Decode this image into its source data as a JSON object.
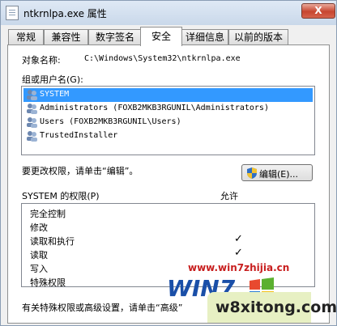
{
  "window": {
    "title": "ntkrnlpa.exe 属性",
    "close_label": "X"
  },
  "tabs": [
    {
      "label": "常规"
    },
    {
      "label": "兼容性"
    },
    {
      "label": "数字签名"
    },
    {
      "label": "安全"
    },
    {
      "label": "详细信息"
    },
    {
      "label": "以前的版本"
    }
  ],
  "active_tab": "安全",
  "object": {
    "label": "对象名称:",
    "value": "C:\\Windows\\System32\\ntkrnlpa.exe"
  },
  "groups": {
    "label": "组或用户名(G):",
    "items": [
      {
        "name": "SYSTEM",
        "selected": true
      },
      {
        "name": "Administrators (FOXB2MKB3RGUNIL\\Administrators)",
        "selected": false
      },
      {
        "name": "Users (FOXB2MKB3RGUNIL\\Users)",
        "selected": false
      },
      {
        "name": "TrustedInstaller",
        "selected": false
      }
    ]
  },
  "change_hint": "要更改权限，请单击“编辑”。",
  "edit_button": "编辑(E)...",
  "permissions": {
    "header_label": "SYSTEM 的权限(P)",
    "allow_label": "允许",
    "rows": [
      {
        "name": "完全控制",
        "allow": ""
      },
      {
        "name": "修改",
        "allow": ""
      },
      {
        "name": "读取和执行",
        "allow": "✓"
      },
      {
        "name": "读取",
        "allow": "✓"
      },
      {
        "name": "写入",
        "allow": ""
      },
      {
        "name": "特殊权限",
        "allow": ""
      }
    ]
  },
  "bottom_hint": "有关特殊权限或高级设置，请单击“高级”",
  "watermark": {
    "url": "www.win7zhijia.cn",
    "logo": "WIN7",
    "badge": "w8xitong.com"
  },
  "colors": {
    "selection": "#3399ff",
    "watermark_red": "#c81e1e",
    "logo_blue": "#1a4fa8"
  }
}
